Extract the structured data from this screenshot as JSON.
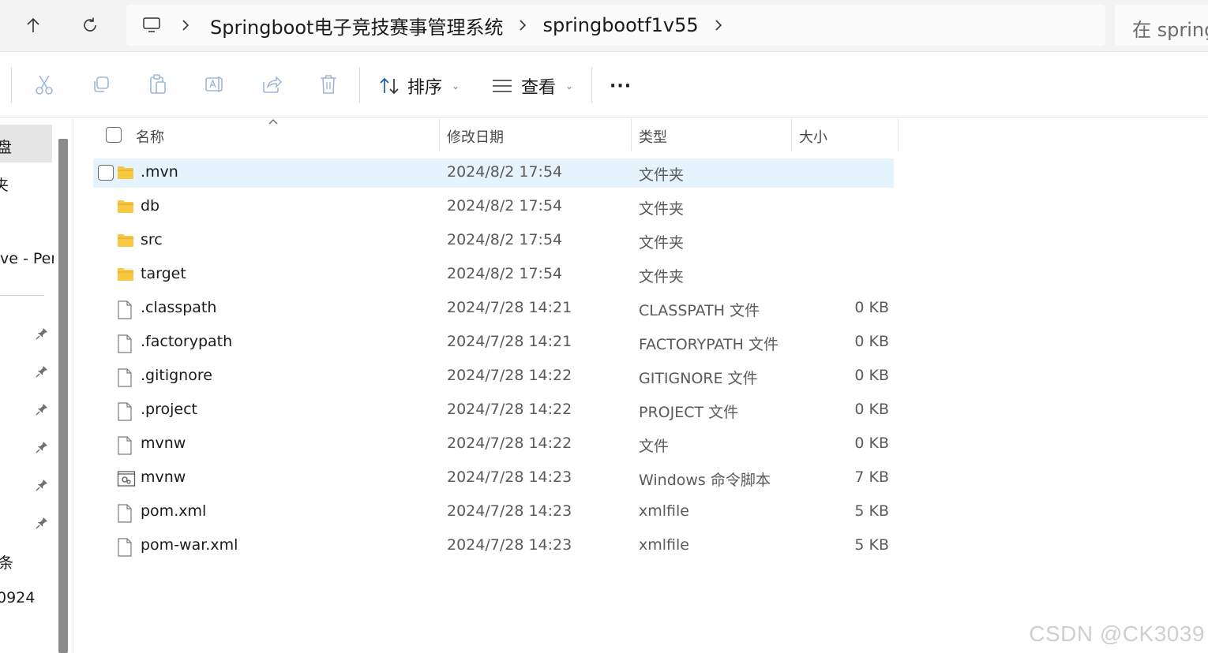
{
  "address": {
    "crumbs": [
      "Springboot电子竞技赛事管理系统",
      "springbootf1v55"
    ],
    "search_placeholder": "在 spring"
  },
  "toolbar": {
    "sort_label": "排序",
    "view_label": "查看",
    "more_label": "···"
  },
  "sidebar": {
    "items": [
      "盘",
      "夹",
      "ve - Per",
      "条",
      "0924"
    ]
  },
  "columns": {
    "name": "名称",
    "modified": "修改日期",
    "type": "类型",
    "size": "大小"
  },
  "files": [
    {
      "name": ".mvn",
      "modified": "2024/8/2 17:54",
      "type": "文件夹",
      "size": "",
      "icon": "folder-icon",
      "selected": true
    },
    {
      "name": "db",
      "modified": "2024/8/2 17:54",
      "type": "文件夹",
      "size": "",
      "icon": "folder-icon"
    },
    {
      "name": "src",
      "modified": "2024/8/2 17:54",
      "type": "文件夹",
      "size": "",
      "icon": "folder-icon"
    },
    {
      "name": "target",
      "modified": "2024/8/2 17:54",
      "type": "文件夹",
      "size": "",
      "icon": "folder-icon"
    },
    {
      "name": ".classpath",
      "modified": "2024/7/28 14:21",
      "type": "CLASSPATH 文件",
      "size": "0 KB",
      "icon": "file-icon"
    },
    {
      "name": ".factorypath",
      "modified": "2024/7/28 14:21",
      "type": "FACTORYPATH 文件",
      "size": "0 KB",
      "icon": "file-icon"
    },
    {
      "name": ".gitignore",
      "modified": "2024/7/28 14:22",
      "type": "GITIGNORE 文件",
      "size": "0 KB",
      "icon": "file-icon"
    },
    {
      "name": ".project",
      "modified": "2024/7/28 14:22",
      "type": "PROJECT 文件",
      "size": "0 KB",
      "icon": "file-icon"
    },
    {
      "name": "mvnw",
      "modified": "2024/7/28 14:22",
      "type": "文件",
      "size": "0 KB",
      "icon": "file-icon"
    },
    {
      "name": "mvnw",
      "modified": "2024/7/28 14:23",
      "type": "Windows 命令脚本",
      "size": "7 KB",
      "icon": "script-file-icon"
    },
    {
      "name": "pom.xml",
      "modified": "2024/7/28 14:23",
      "type": "xmlfile",
      "size": "5 KB",
      "icon": "file-icon"
    },
    {
      "name": "pom-war.xml",
      "modified": "2024/7/28 14:23",
      "type": "xmlfile",
      "size": "5 KB",
      "icon": "file-icon"
    }
  ],
  "watermark": "CSDN @CK3039",
  "colors": {
    "selection": "#e5f3fd",
    "folder": "#f8c842",
    "toolbar_disabled": "#9db7d6"
  }
}
